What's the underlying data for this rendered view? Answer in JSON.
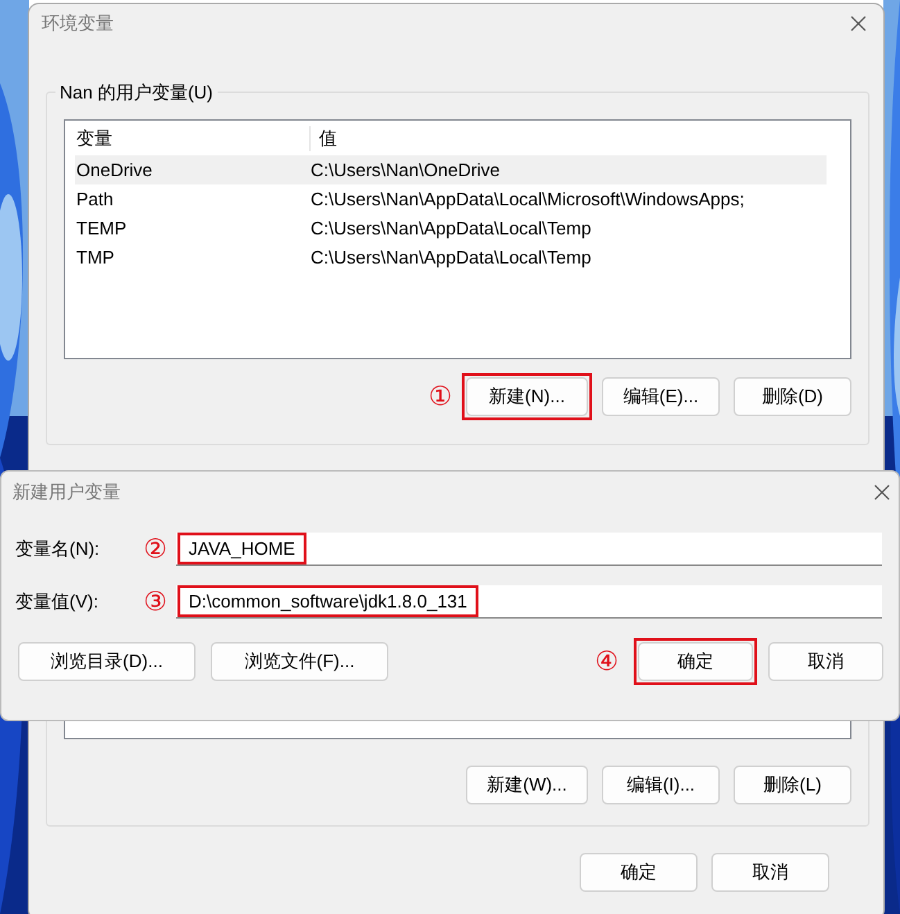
{
  "main_window": {
    "title": "环境变量",
    "user_vars": {
      "label": "Nan 的用户变量(U)",
      "columns": [
        "变量",
        "值"
      ],
      "rows": [
        {
          "name": "OneDrive",
          "value": "C:\\Users\\Nan\\OneDrive",
          "selected": true
        },
        {
          "name": "Path",
          "value": "C:\\Users\\Nan\\AppData\\Local\\Microsoft\\WindowsApps;",
          "selected": false
        },
        {
          "name": "TEMP",
          "value": "C:\\Users\\Nan\\AppData\\Local\\Temp",
          "selected": false
        },
        {
          "name": "TMP",
          "value": "C:\\Users\\Nan\\AppData\\Local\\Temp",
          "selected": false
        }
      ],
      "buttons": [
        {
          "label": "新建(N)...",
          "highlighted": true,
          "marker": "①"
        },
        {
          "label": "编辑(E)...",
          "highlighted": false
        },
        {
          "label": "删除(D)",
          "highlighted": false
        }
      ]
    },
    "system_vars": {
      "buttons": [
        {
          "label": "新建(W)...",
          "highlighted": false
        },
        {
          "label": "编辑(I)...",
          "highlighted": false
        },
        {
          "label": "删除(L)",
          "highlighted": false
        }
      ]
    },
    "buttons": [
      {
        "label": "确定",
        "highlighted": false
      },
      {
        "label": "取消",
        "highlighted": false
      }
    ]
  },
  "dialog": {
    "title": "新建用户变量",
    "fields": [
      {
        "label": "变量名(N):",
        "value": "JAVA_HOME",
        "highlighted": true,
        "marker": "②"
      },
      {
        "label": "变量值(V):",
        "value": "D:\\common_software\\jdk1.8.0_131",
        "highlighted": true,
        "marker": "③"
      }
    ],
    "browse_buttons": [
      {
        "label": "浏览目录(D)...",
        "highlighted": false
      },
      {
        "label": "浏览文件(F)...",
        "highlighted": false
      }
    ],
    "buttons": [
      {
        "label": "确定",
        "highlighted": true,
        "marker": "④"
      },
      {
        "label": "取消",
        "highlighted": false
      }
    ]
  }
}
